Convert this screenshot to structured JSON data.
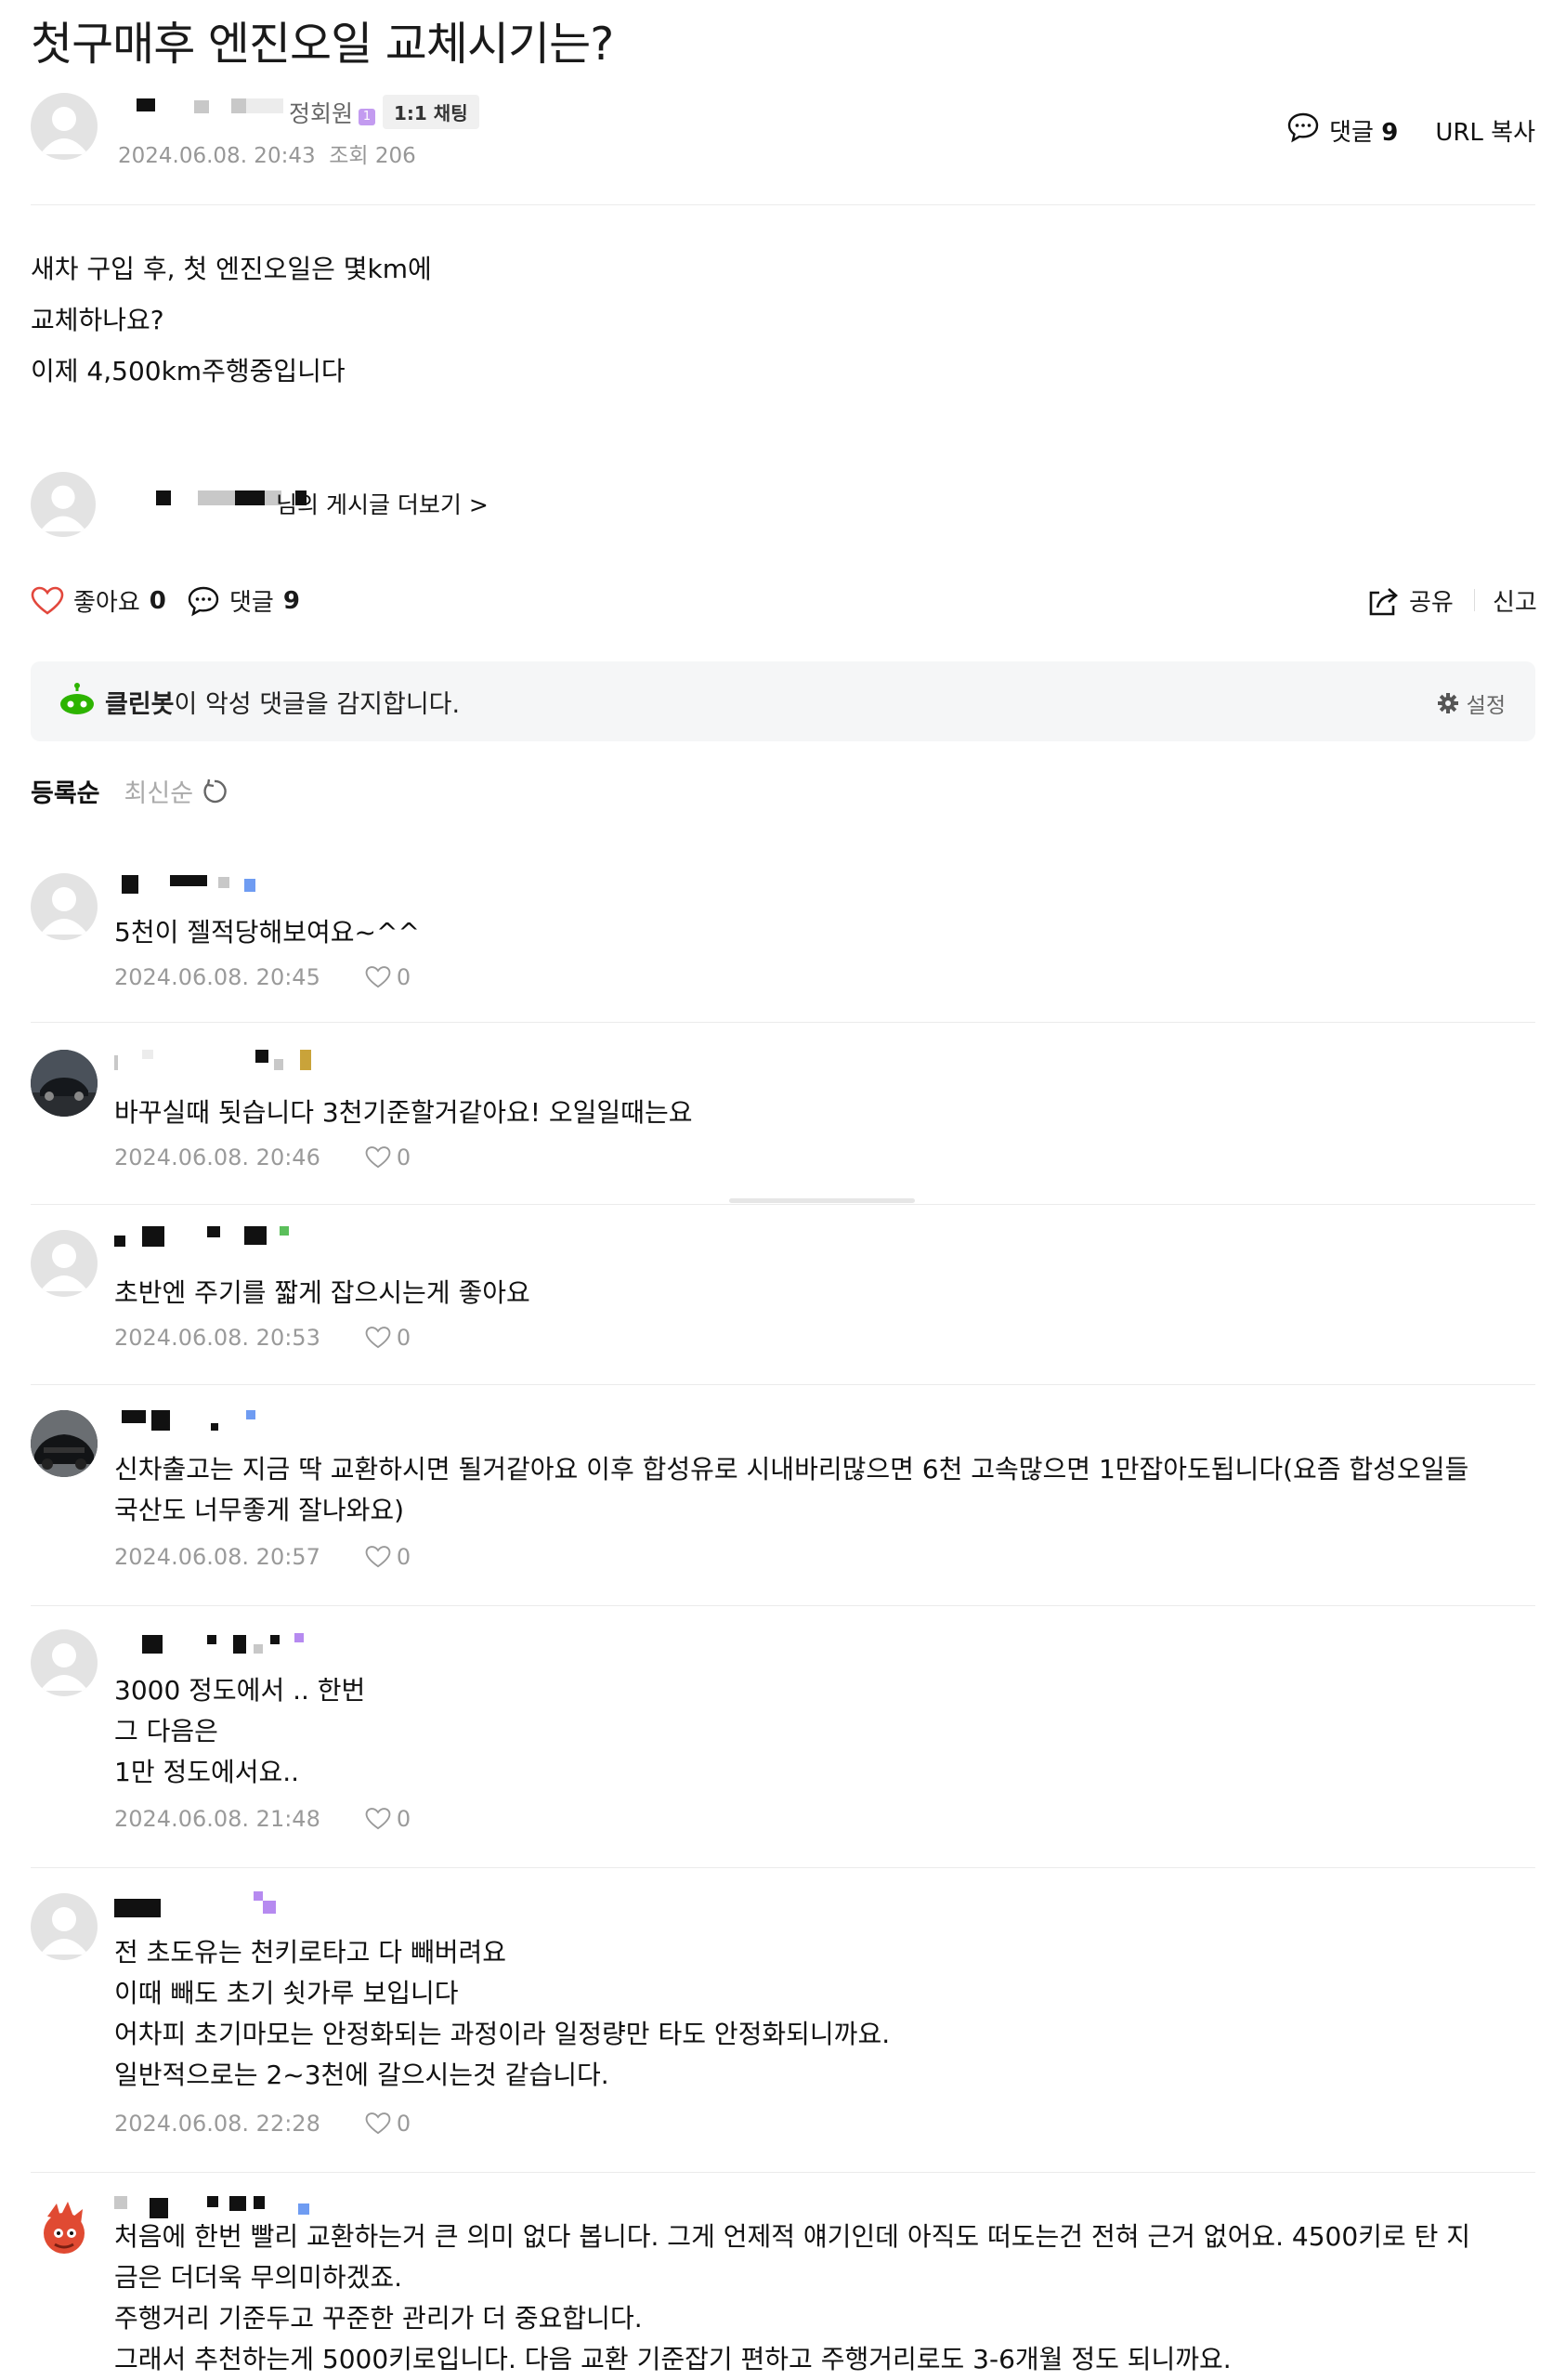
{
  "post": {
    "title": "첫구매후 엔진오일 교체시기는?",
    "author_grade": "정회원",
    "grade_level": "1",
    "chat_button": "1:1 채팅",
    "date": "2024.06.08. 20:43",
    "views": "조회 206",
    "comment_label": "댓글",
    "comment_count": "9",
    "url_copy": "URL 복사",
    "body_lines": [
      "새차 구입 후, 첫 엔진오일은 몇km에",
      "교체하나요?",
      "이제 4,500km주행중입니다"
    ],
    "more_posts_suffix": "님의 게시글 더보기 >"
  },
  "actions": {
    "like_label": "좋아요",
    "like_count": "0",
    "comment_label": "댓글",
    "comment_count": "9",
    "share_label": "공유",
    "report_label": "신고"
  },
  "cleanbot": {
    "name": "클린봇",
    "message": "이 악성 댓글을 감지합니다.",
    "settings_label": "설정"
  },
  "sort": {
    "by_registration": "등록순",
    "by_latest": "최신순"
  },
  "comments": [
    {
      "text": "5천이 젤적당해보여요~^^",
      "date": "2024.06.08. 20:45",
      "likes": "0"
    },
    {
      "text": "바꾸실때 됫습니다 3천기준할거같아요! 오일일때는요",
      "date": "2024.06.08. 20:46",
      "likes": "0"
    },
    {
      "text": "초반엔 주기를 짧게 잡으시는게 좋아요",
      "date": "2024.06.08. 20:53",
      "likes": "0"
    },
    {
      "text": "신차출고는 지금 딱 교환하시면 될거같아요 이후 합성유로 시내바리많으면 6천 고속많으면 1만잡아도됩니다(요즘 합성오일들\n국산도 너무좋게 잘나와요)",
      "date": "2024.06.08. 20:57",
      "likes": "0"
    },
    {
      "text": "3000 정도에서 .. 한번\n그 다음은\n1만 정도에서요..",
      "date": "2024.06.08. 21:48",
      "likes": "0"
    },
    {
      "text": "전 초도유는 천키로타고 다 빼버려요\n이때 빼도 초기 쇳가루 보입니다\n어차피 초기마모는 안정화되는 과정이라 일정량만 타도 안정화되니까요.\n일반적으로는 2~3천에 갈으시는것 같습니다.",
      "date": "2024.06.08. 22:28",
      "likes": "0"
    },
    {
      "text": "처음에 한번 빨리 교환하는거 큰 의미 없다 봅니다. 그게 언제적 얘기인데 아직도 떠도는건 전혀 근거 없어요. 4500키로 탄 지\n금은 더더욱 무의미하겠죠.\n주행거리 기준두고 꾸준한 관리가 더 중요합니다.\n그래서 추천하는게 5000키로입니다. 다음 교환 기준잡기 편하고 주행거리로도 3-6개월 정도 되니까요.",
      "date": "",
      "likes": ""
    }
  ]
}
